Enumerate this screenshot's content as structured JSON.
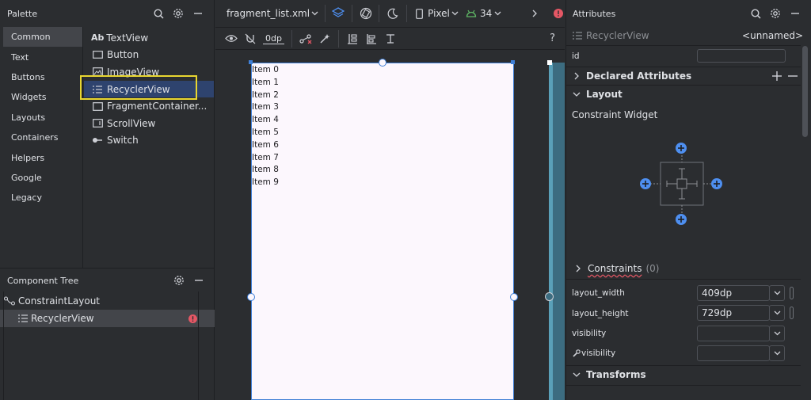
{
  "palette": {
    "title": "Palette",
    "categories": [
      "Common",
      "Text",
      "Buttons",
      "Widgets",
      "Layouts",
      "Containers",
      "Helpers",
      "Google",
      "Legacy"
    ],
    "items": [
      {
        "icon": "Ab",
        "label": "TextView"
      },
      {
        "icon": "button-icon",
        "label": "Button"
      },
      {
        "icon": "image-icon",
        "label": "ImageView"
      },
      {
        "icon": "list-icon",
        "label": "RecyclerView"
      },
      {
        "icon": "fragment-icon",
        "label": "FragmentContainer..."
      },
      {
        "icon": "scroll-icon",
        "label": "ScrollView"
      },
      {
        "icon": "switch-icon",
        "label": "Switch"
      }
    ]
  },
  "tree": {
    "title": "Component Tree",
    "items": [
      {
        "label": "ConstraintLayout"
      },
      {
        "label": "RecyclerView"
      }
    ]
  },
  "editor": {
    "file_name": "fragment_list.xml",
    "device": "Pixel",
    "api_level": "34",
    "margin_value": "0dp",
    "help": "?",
    "list_items": [
      "Item 0",
      "Item 1",
      "Item 2",
      "Item 3",
      "Item 4",
      "Item 5",
      "Item 6",
      "Item 7",
      "Item 8",
      "Item 9"
    ]
  },
  "attributes": {
    "title": "Attributes",
    "component": "RecyclerView",
    "component_id_hint": "<unnamed>",
    "id_label": "id",
    "id_value": "",
    "declared_label": "Declared Attributes",
    "layout_label": "Layout",
    "constraint_widget_label": "Constraint Widget",
    "constraints_label": "Constraints",
    "constraints_count": "(0)",
    "layout_width_label": "layout_width",
    "layout_width_value": "409dp",
    "layout_height_label": "layout_height",
    "layout_height_value": "729dp",
    "visibility_label": "visibility",
    "visibility_value": "",
    "tools_visibility_label": "visibility",
    "tools_visibility_value": "",
    "transforms_label": "Transforms"
  },
  "colors": {
    "accent": "#3f7fd6",
    "selection": "#2e436e",
    "highlight": "#e8d630",
    "error": "#e55765",
    "api_green": "#5fb865"
  }
}
